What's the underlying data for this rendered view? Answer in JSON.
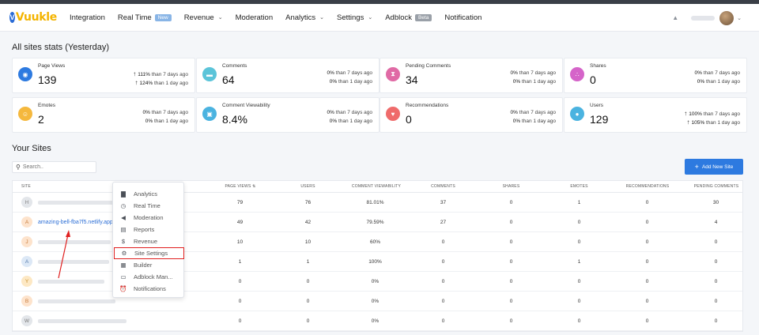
{
  "nav": {
    "logo_text": "Vuukle",
    "items": [
      {
        "label": "Integration"
      },
      {
        "label": "Real Time",
        "badge": "New"
      },
      {
        "label": "Revenue",
        "chevron": true
      },
      {
        "label": "Moderation"
      },
      {
        "label": "Analytics",
        "chevron": true
      },
      {
        "label": "Settings",
        "chevron": true
      },
      {
        "label": "Adblock",
        "badge": "Beta"
      },
      {
        "label": "Notification"
      }
    ]
  },
  "stats_title": "All sites stats (Yesterday)",
  "stats": [
    {
      "label": "Page Views",
      "value": "139",
      "icon": "eye-icon",
      "color": "#2d7ae0",
      "cmp7": "111%",
      "cmp1": "124%",
      "arrow": true
    },
    {
      "label": "Comments",
      "value": "64",
      "icon": "chat-icon",
      "color": "#5bc4d9",
      "cmp7": "0%",
      "cmp1": "0%"
    },
    {
      "label": "Pending Comments",
      "value": "34",
      "icon": "hourglass-icon",
      "color": "#e06aa5",
      "cmp7": "0%",
      "cmp1": "0%"
    },
    {
      "label": "Shares",
      "value": "0",
      "icon": "share-icon",
      "color": "#d564c9",
      "cmp7": "0%",
      "cmp1": "0%"
    },
    {
      "label": "Emotes",
      "value": "2",
      "icon": "smiley-icon",
      "color": "#f5b83d",
      "cmp7": "0%",
      "cmp1": "0%"
    },
    {
      "label": "Comment Viewability",
      "value": "8.4%",
      "icon": "viewability-icon",
      "color": "#4bb3e0",
      "cmp7": "0%",
      "cmp1": "0%"
    },
    {
      "label": "Recommendations",
      "value": "0",
      "icon": "heart-icon",
      "color": "#ef6b6b",
      "cmp7": "0%",
      "cmp1": "0%"
    },
    {
      "label": "Users",
      "value": "129",
      "icon": "user-icon",
      "color": "#4bb3e0",
      "cmp7": "100%",
      "cmp1": "105%",
      "arrow": true
    }
  ],
  "cmp7_suffix": "than 7 days ago",
  "cmp1_suffix": "than 1 day ago",
  "sites_title": "Your Sites",
  "search": {
    "placeholder": "Search.."
  },
  "add_site_label": "Add New Site",
  "table": {
    "headers": {
      "site": "SITE",
      "page_views": "PAGE VIEWS",
      "users": "USERS",
      "viewability": "COMMENT VIEWABILITY",
      "comments": "COMMENTS",
      "shares": "SHARES",
      "emotes": "EMOTES",
      "recommendations": "RECOMMENDATIONS",
      "pending": "PENDING COMMENTS"
    },
    "rows": [
      {
        "letter": "H",
        "bg": "#e3e6ea",
        "fg": "#888",
        "site": "",
        "pv": "79",
        "users": "76",
        "cv": "81.01%",
        "comments": "37",
        "shares": "0",
        "emotes": "1",
        "recs": "0",
        "pending": "30"
      },
      {
        "letter": "A",
        "bg": "#fde3cc",
        "fg": "#c77a3a",
        "site": "amazing-bell-fba7f5.netlify.app",
        "pv": "49",
        "users": "42",
        "cv": "79.59%",
        "comments": "27",
        "shares": "0",
        "emotes": "0",
        "recs": "0",
        "pending": "4"
      },
      {
        "letter": "J",
        "bg": "#fde3cc",
        "fg": "#c77a3a",
        "site": "",
        "pv": "10",
        "users": "10",
        "cv": "60%",
        "comments": "0",
        "shares": "0",
        "emotes": "0",
        "recs": "0",
        "pending": "0"
      },
      {
        "letter": "A",
        "bg": "#dce8f6",
        "fg": "#5a7fae",
        "site": "",
        "pv": "1",
        "users": "1",
        "cv": "100%",
        "comments": "0",
        "shares": "0",
        "emotes": "1",
        "recs": "0",
        "pending": "0"
      },
      {
        "letter": "Y",
        "bg": "#fde8c4",
        "fg": "#c79030",
        "site": "",
        "pv": "0",
        "users": "0",
        "cv": "0%",
        "comments": "0",
        "shares": "0",
        "emotes": "0",
        "recs": "0",
        "pending": "0"
      },
      {
        "letter": "B",
        "bg": "#fde3cc",
        "fg": "#c77a3a",
        "site": "",
        "pv": "0",
        "users": "0",
        "cv": "0%",
        "comments": "0",
        "shares": "0",
        "emotes": "0",
        "recs": "0",
        "pending": "0"
      },
      {
        "letter": "W",
        "bg": "#e3e6ea",
        "fg": "#777",
        "site": "",
        "pv": "0",
        "users": "0",
        "cv": "0%",
        "comments": "0",
        "shares": "0",
        "emotes": "0",
        "recs": "0",
        "pending": "0"
      }
    ]
  },
  "context_menu": [
    {
      "label": "Analytics",
      "icon": "bar-chart-icon"
    },
    {
      "label": "Real Time",
      "icon": "clock-icon"
    },
    {
      "label": "Moderation",
      "icon": "megaphone-icon"
    },
    {
      "label": "Reports",
      "icon": "book-icon"
    },
    {
      "label": "Revenue",
      "icon": "dollar-icon"
    },
    {
      "label": "Site Settings",
      "icon": "gear-icon",
      "highlighted": true
    },
    {
      "label": "Builder",
      "icon": "builder-icon"
    },
    {
      "label": "Adblock Man...",
      "icon": "adblock-icon"
    },
    {
      "label": "Notifications",
      "icon": "alarm-icon"
    }
  ]
}
